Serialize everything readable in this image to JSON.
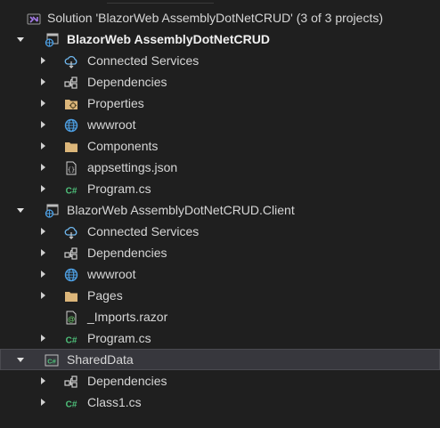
{
  "solution": {
    "label": "Solution 'BlazorWeb AssemblyDotNetCRUD' (3 of 3 projects)",
    "icon": "visual-studio-solution-icon"
  },
  "projects": [
    {
      "label": "BlazorWeb AssemblyDotNetCRUD",
      "icon": "web-project-icon",
      "expanded": true,
      "bold": true,
      "items": [
        {
          "label": "Connected Services",
          "icon": "connected-services-icon",
          "expandable": true
        },
        {
          "label": "Dependencies",
          "icon": "dependencies-icon",
          "expandable": true
        },
        {
          "label": "Properties",
          "icon": "properties-folder-icon",
          "expandable": true
        },
        {
          "label": "wwwroot",
          "icon": "globe-icon",
          "expandable": true
        },
        {
          "label": "Components",
          "icon": "folder-icon",
          "expandable": true
        },
        {
          "label": "appsettings.json",
          "icon": "json-file-icon",
          "expandable": true
        },
        {
          "label": "Program.cs",
          "icon": "csharp-file-icon",
          "expandable": true
        }
      ]
    },
    {
      "label": "BlazorWeb AssemblyDotNetCRUD.Client",
      "icon": "web-project-icon",
      "expanded": true,
      "bold": false,
      "items": [
        {
          "label": "Connected Services",
          "icon": "connected-services-icon",
          "expandable": true
        },
        {
          "label": "Dependencies",
          "icon": "dependencies-icon",
          "expandable": true
        },
        {
          "label": "wwwroot",
          "icon": "globe-icon",
          "expandable": true
        },
        {
          "label": "Pages",
          "icon": "folder-icon",
          "expandable": true
        },
        {
          "label": "_Imports.razor",
          "icon": "razor-file-icon",
          "expandable": false
        },
        {
          "label": "Program.cs",
          "icon": "csharp-file-icon",
          "expandable": true
        }
      ]
    },
    {
      "label": "SharedData",
      "icon": "csharp-project-icon",
      "expanded": true,
      "bold": false,
      "selected": true,
      "items": [
        {
          "label": "Dependencies",
          "icon": "dependencies-icon",
          "expandable": true
        },
        {
          "label": "Class1.cs",
          "icon": "csharp-file-icon",
          "expandable": true
        }
      ]
    }
  ],
  "colors": {
    "background": "#1f1f1f",
    "selected_row": "#37373d",
    "text": "#d6d6d6",
    "csharp_green": "#4ec07a",
    "folder_yellow": "#dcb67a",
    "vs_purple": "#a57be8",
    "accent_blue": "#4ea1e6"
  }
}
